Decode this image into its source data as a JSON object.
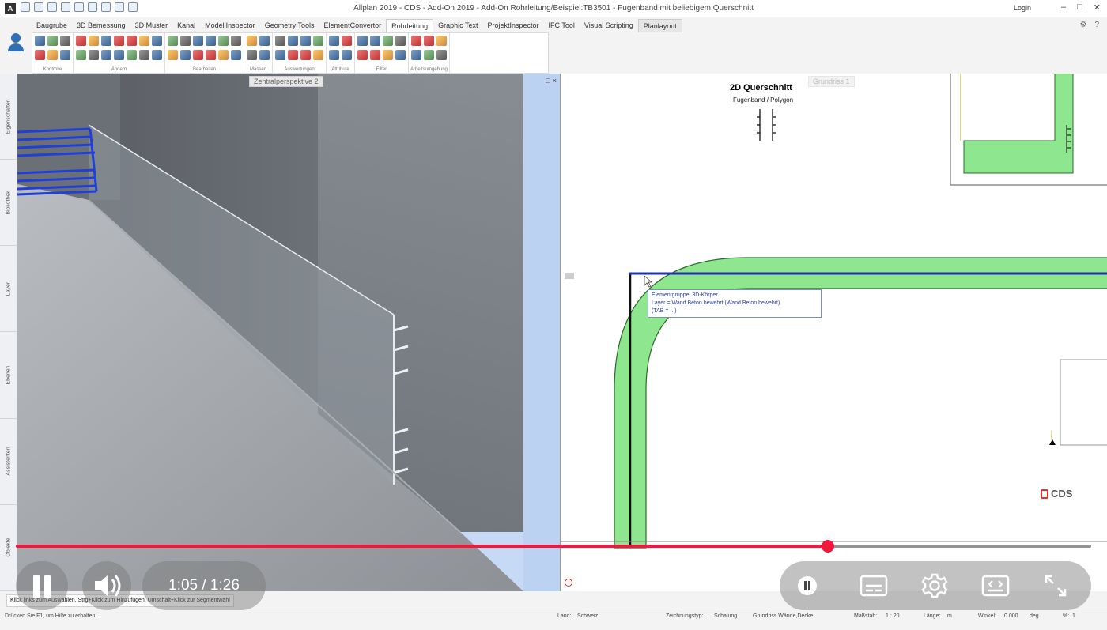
{
  "window": {
    "title": "Allplan 2019 - CDS - Add-On 2019 - Add-On Rohrleitung/Beispiel:TB3501 - Fugenband mit beliebigem Querschnitt",
    "login_label": "Login",
    "app_letter": "A"
  },
  "tabs": [
    "Baugrube",
    "3D Bemessung",
    "3D Muster",
    "Kanal",
    "ModellInspector",
    "Geometry Tools",
    "ElementConvertor",
    "Rohrleitung",
    "Graphic Text",
    "ProjektInspector",
    "IFC Tool",
    "Visual Scripting",
    "Planlayout"
  ],
  "active_tab": "Rohrleitung",
  "ribbon_groups": [
    {
      "label": "Kontrolle",
      "cols": 3
    },
    {
      "label": "Ändern",
      "cols": 7
    },
    {
      "label": "Bearbeiten",
      "cols": 6
    },
    {
      "label": "Massen",
      "cols": 2
    },
    {
      "label": "Auswertungen",
      "cols": 4
    },
    {
      "label": "Attribute",
      "cols": 2
    },
    {
      "label": "Filter",
      "cols": 4
    },
    {
      "label": "Arbeitsumgebung",
      "cols": 3
    }
  ],
  "sidebar_tabs": [
    "Eigenschaften",
    "Bibliothek",
    "Layer",
    "Ebenen",
    "Assistenten",
    "Objekte"
  ],
  "viewport3d": {
    "label": "Zentralperspektive 2",
    "controls": [
      "□",
      "×"
    ]
  },
  "viewport2d": {
    "label": "Grundriss 1",
    "section_title": "2D Querschnitt",
    "section_subtitle": "Fugenband / Polygon",
    "tooltip": {
      "line1": "Elementgruppe: 3D-Körper",
      "line2": "Layer              = Wand Beton bewehrt (Wand Beton bewehrt)",
      "line3": "(TAB = ...)"
    },
    "logo_text": "CDS",
    "colors": {
      "fill": "#8ee68e",
      "outline": "#2c6b2c",
      "selection": "#2233aa"
    }
  },
  "hint": "Klick links zum Auswählen, Strg+Klick zum Hinzufügen, Umschalt+Klick zur Segmentwahl",
  "statusbar": {
    "help": "Drücken Sie F1, um Hilfe zu erhalten.",
    "land_label": "Land:",
    "land_value": "Schweiz",
    "type_label": "Zeichnungstyp:",
    "type_value": "Schalung",
    "plan_value": "Grundriss Wände,Decke",
    "scale_label": "Maßstab:",
    "scale_value": "1 : 20",
    "length_label": "Länge:",
    "length_value": "m",
    "angle_label": "Winkel:",
    "angle_value": "0.000",
    "angle_unit": "deg",
    "percent_label": "%:",
    "percent_value": "1"
  },
  "player": {
    "current_time": "1:05",
    "total_time": "1:26",
    "time_display": "1:05 / 1:26",
    "progress": 0.755,
    "accent": "#f0183c",
    "buttons": [
      "pause-icon",
      "volume-icon",
      "pause-icon",
      "subtitles-icon",
      "settings-gear-icon",
      "theater-mode-icon",
      "fullscreen-icon"
    ]
  }
}
